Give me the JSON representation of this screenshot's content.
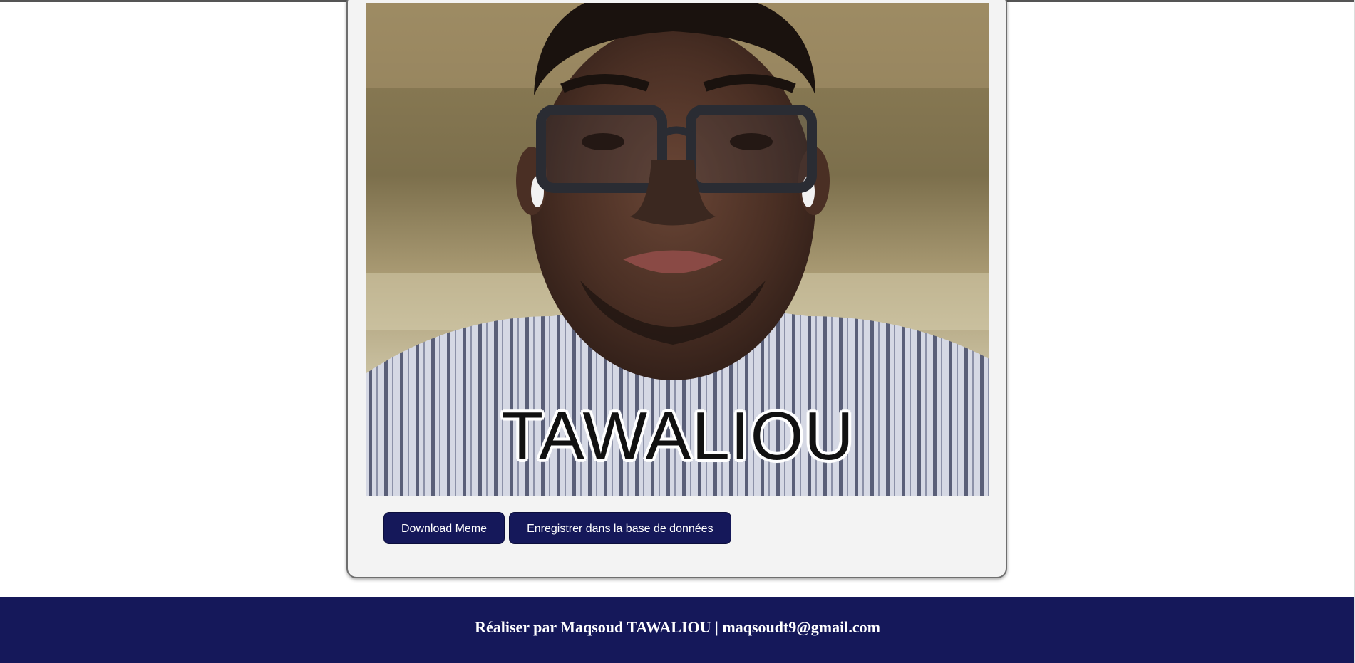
{
  "meme": {
    "caption": "TAWALIOU",
    "photo_alt": "portrait photo of a man with glasses"
  },
  "actions": {
    "download_label": "Download Meme",
    "save_label": "Enregistrer dans la base de données"
  },
  "footer": {
    "text": "Réaliser par Maqsoud TAWALIOU | maqsoudt9@gmail.com"
  },
  "colors": {
    "brand_navy": "#15185a",
    "card_bg": "#f3f3f3",
    "page_bg": "#ffffff"
  }
}
